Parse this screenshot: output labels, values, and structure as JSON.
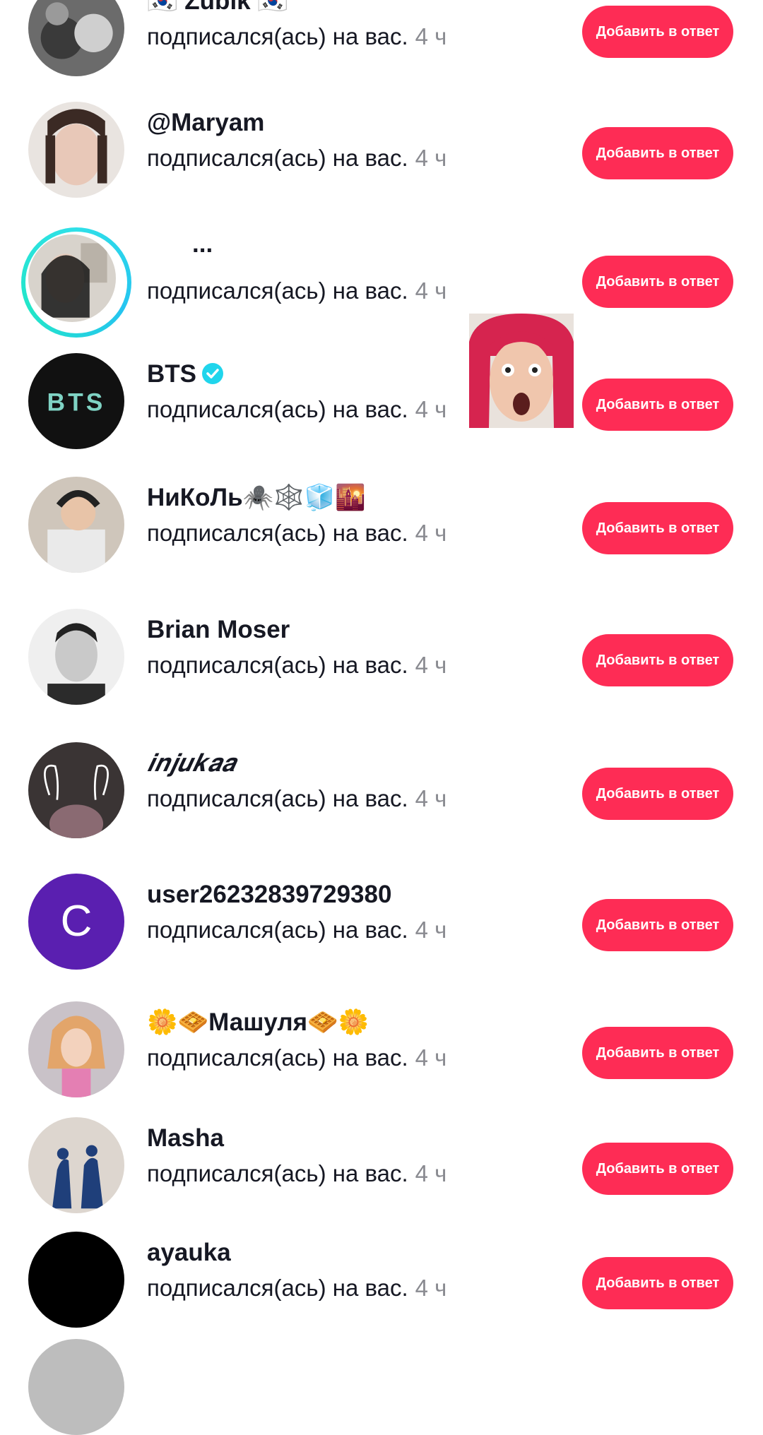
{
  "list": {
    "subtitle": "подписался(ась) на вас.",
    "time": "4 ч",
    "button_label": "Добавить в ответ",
    "items": [
      {
        "name": "🇰🇷 Zubik 🇰🇷"
      },
      {
        "name": "@Maryam"
      },
      {
        "name": "..."
      },
      {
        "name": "BTS",
        "verified": true
      },
      {
        "name": "НиКоЛь🕷️🕸️🧊🌇"
      },
      {
        "name": "Brian Moser"
      },
      {
        "name": "𝒊𝒏𝒋𝒖𝒌𝒂𝒂"
      },
      {
        "name": "user26232839729380",
        "avatar_letter": "C"
      },
      {
        "name": "🌼🧇Машуля🧇🌼"
      },
      {
        "name": "Masha"
      },
      {
        "name": "ayauka"
      }
    ]
  },
  "colors": {
    "accent": "#fe2c55",
    "story_ring": "#25c4f0",
    "verified": "#20d5ec",
    "letter_avatar": "#5a1fb0"
  },
  "icons": [
    "verified-badge-icon",
    "checkmark-icon"
  ],
  "overlay": {
    "sticker": "reaction-face-sticker"
  }
}
